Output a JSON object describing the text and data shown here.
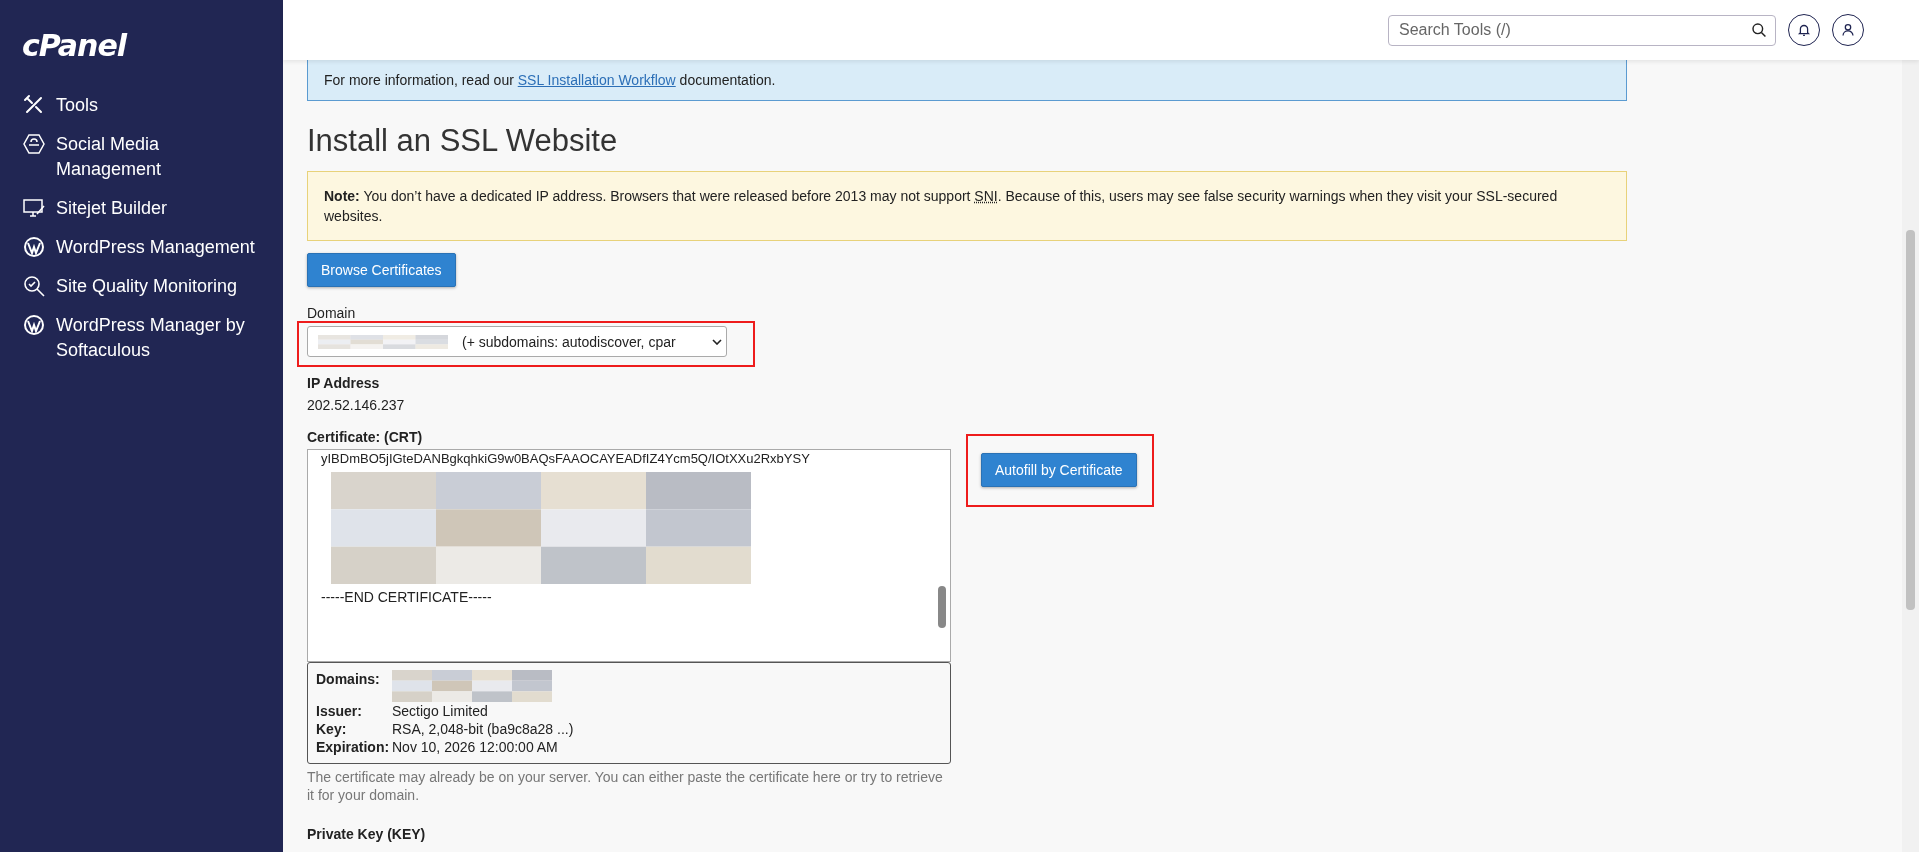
{
  "sidebar": {
    "logo": "cPanel",
    "items": [
      {
        "label": "Tools",
        "kind": "tools"
      },
      {
        "label": "Social Media Management",
        "kind": "hexagon"
      },
      {
        "label": "Sitejet Builder",
        "kind": "monitor"
      },
      {
        "label": "WordPress Management",
        "kind": "wordpress"
      },
      {
        "label": "Site Quality Monitoring",
        "kind": "magnifier"
      },
      {
        "label": "WordPress Manager by Softaculous",
        "kind": "wordpress"
      }
    ]
  },
  "topbar": {
    "search": {
      "placeholder": "Search Tools (/)"
    }
  },
  "info": {
    "before": "For more information, read our ",
    "link": "SSL Installation Workflow",
    "after": " documentation."
  },
  "title": "Install an SSL Website",
  "note": {
    "text": "**Note:** You don’t have a dedicated IP address. Browsers that were released before 2013 may not support ",
    "abbr": "SNI",
    "after": ". Because of this, users may see false security warnings when they visit your SSL-secured websites."
  },
  "browse_button": "Browse Certificates",
  "domain": {
    "label": "Domain",
    "value": "(+ subdomains: autodiscover, cpar",
    "highlighted": true
  },
  "ip": {
    "label": "IP Address",
    "value": "202.52.146.237"
  },
  "certificate": {
    "label": "Certificate: (CRT)",
    "first_line": "yIBDmBO5jIGteDANBgkqhkiG9w0BAQsFAAOCAYEADfIZ4Ycm5Q/IOtXXu2RxbYSY",
    "last_line": "-----END CERTIFICATE-----",
    "autofill_button": {
      "label": "Autofill by Certificate",
      "highlighted": true
    },
    "details": [
      {
        "kind": "hidden",
        "label": "Domains:"
      },
      {
        "kind": "text",
        "label": "Issuer:",
        "value": "Sectigo Limited"
      },
      {
        "kind": "text",
        "label": "Key:",
        "value": "RSA, 2,048-bit (ba9c8a28 ...)"
      },
      {
        "kind": "text",
        "label": "Expiration:",
        "value": "Nov 10, 2026 12:00:00 AM"
      }
    ],
    "help": "The certificate may already be on your server. You can either paste the certificate here or try to retrieve it for your domain."
  },
  "private_key": {
    "label": "Private Key (KEY)"
  }
}
